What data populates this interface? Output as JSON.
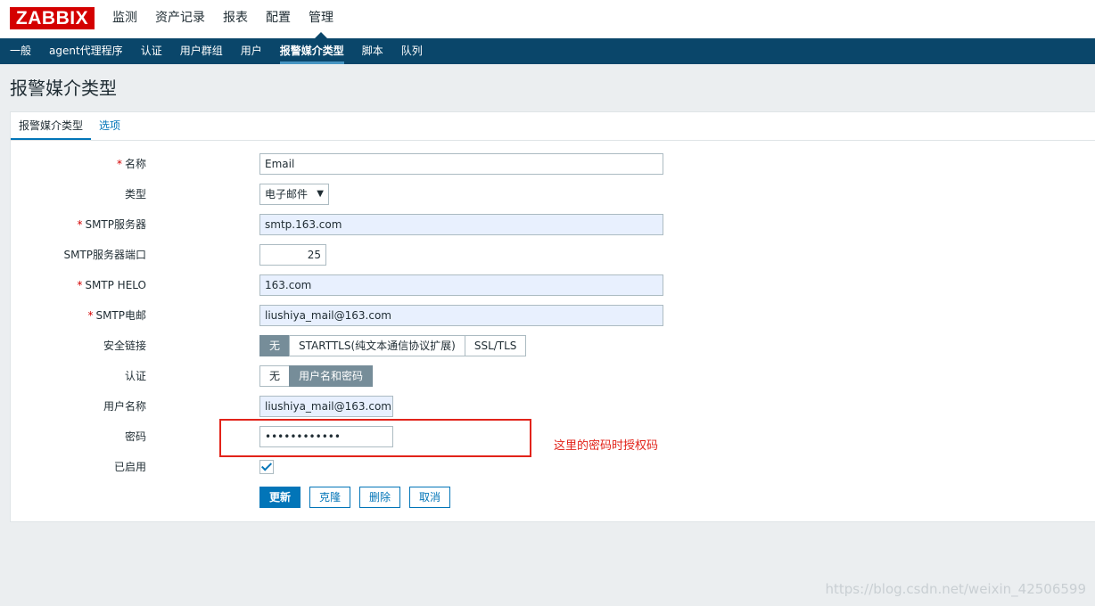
{
  "header": {
    "logo": "ZABBIX",
    "menu": [
      {
        "label": "监测",
        "active": false
      },
      {
        "label": "资产记录",
        "active": false
      },
      {
        "label": "报表",
        "active": false
      },
      {
        "label": "配置",
        "active": false
      },
      {
        "label": "管理",
        "active": true
      }
    ]
  },
  "subnav": [
    {
      "label": "一般"
    },
    {
      "label": "agent代理程序"
    },
    {
      "label": "认证"
    },
    {
      "label": "用户群组"
    },
    {
      "label": "用户"
    },
    {
      "label": "报警媒介类型",
      "active": true
    },
    {
      "label": "脚本"
    },
    {
      "label": "队列"
    }
  ],
  "page_title": "报警媒介类型",
  "tabs": [
    {
      "label": "报警媒介类型",
      "active": true
    },
    {
      "label": "选项",
      "active": false
    }
  ],
  "form": {
    "name": {
      "label": "名称",
      "value": "Email"
    },
    "type": {
      "label": "类型",
      "value": "电子邮件",
      "arrow": "▼"
    },
    "smtp_server": {
      "label": "SMTP服务器",
      "value": "smtp.163.com"
    },
    "smtp_port": {
      "label": "SMTP服务器端口",
      "value": "25"
    },
    "smtp_helo": {
      "label": "SMTP HELO",
      "value": "163.com"
    },
    "smtp_email": {
      "label": "SMTP电邮",
      "value": "liushiya_mail@163.com"
    },
    "security": {
      "label": "安全链接",
      "options": [
        "无",
        "STARTTLS(纯文本通信协议扩展)",
        "SSL/TLS"
      ],
      "selected": 0
    },
    "auth": {
      "label": "认证",
      "options": [
        "无",
        "用户名和密码"
      ],
      "selected": 1
    },
    "username": {
      "label": "用户名称",
      "value": "liushiya_mail@163.com"
    },
    "password": {
      "label": "密码",
      "value": "••••••••••••"
    },
    "enabled": {
      "label": "已启用",
      "checked": true
    },
    "required_mark": "*"
  },
  "buttons": {
    "update": "更新",
    "clone": "克隆",
    "delete": "删除",
    "cancel": "取消"
  },
  "annotation": "这里的密码时授权码",
  "watermark": "https://blog.csdn.net/weixin_42506599",
  "colors": {
    "brand": "#d40000",
    "nav_bg": "#0a466a",
    "accent": "#0275b8",
    "annotation": "#e2231a"
  }
}
